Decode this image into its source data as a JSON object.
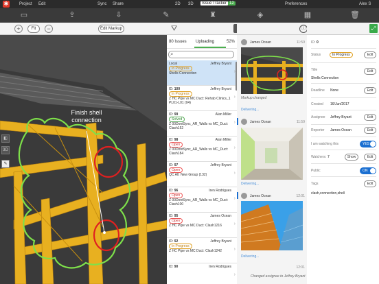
{
  "menubar": {
    "project": "Project",
    "edit": "Edit",
    "sync": "Sync",
    "share": "Share",
    "view_2d": "2D",
    "view_3d": "3D",
    "issue_tracker": "Issue Tracker",
    "issue_badge": "12",
    "preferences": "Preferences",
    "user": "Alex S"
  },
  "left_panel": {
    "zoom_in": "+",
    "fit": "Fit",
    "zoom_out": "−",
    "edit_markup": "Edit Markup",
    "markup_text": "Finish shell connection"
  },
  "list_panel": {
    "tabs": [
      {
        "label": "80 Issues"
      },
      {
        "label": "Uploading"
      }
    ],
    "upload_percent": "52%",
    "issues": [
      {
        "id_label": "Local",
        "id": "",
        "assignee": "Jeffrey Bryant",
        "status": "In Progress",
        "status_class": "inprog",
        "title": "Shells Connection",
        "selected": true
      },
      {
        "id_label": "ID:",
        "id": "100",
        "assignee": "Jeffrey Bryant",
        "status": "In Progress",
        "status_class": "inprog",
        "title": "Z HC Pipe vs MC Duct: Rehab Clinics_1 PL01-L01 (04)"
      },
      {
        "id_label": "ID:",
        "id": "99",
        "assignee": "Alan Miller",
        "status": "Solved",
        "status_class": "solved",
        "title": "Z 00DontSync_AR_Walls vs MC_Duct: Clash152"
      },
      {
        "id_label": "ID:",
        "id": "98",
        "assignee": "Alan Miller",
        "status": "Open",
        "status_class": "open",
        "title": "Z 00DontSync_AR_Walls vs MC_Duct: Clash184"
      },
      {
        "id_label": "ID:",
        "id": "97",
        "assignee": "Jeffrey Bryant",
        "status": "Open",
        "status_class": "open",
        "title": "QC All: New Group (132)"
      },
      {
        "id_label": "ID:",
        "id": "96",
        "assignee": "Iren Rodrigues",
        "status": "Open",
        "status_class": "open",
        "title": "Z 00DontSync_AR_Walls vs MC_Duct: Clash100"
      },
      {
        "id_label": "ID:",
        "id": "95",
        "assignee": "James Ocean",
        "status": "Open",
        "status_class": "open",
        "title": "Z HC Pipe vs MC Duct: Clash1216"
      },
      {
        "id_label": "ID:",
        "id": "92",
        "assignee": "Jeffrey Bryant",
        "status": "In Progress",
        "status_class": "inprog",
        "title": "Z HC Pipe vs MC Duct: Clash1242"
      },
      {
        "id_label": "ID:",
        "id": "90",
        "assignee": "Iren Rodrigues",
        "status": "",
        "status_class": "",
        "title": ""
      }
    ]
  },
  "messages": [
    {
      "name": "James Ocean",
      "time": "11:59",
      "caption": "Markup changed",
      "delivery": "Delivering..."
    },
    {
      "name": "James Ocean",
      "time": "11:59",
      "caption": "",
      "delivery": "Delivering..."
    },
    {
      "name": "James Ocean",
      "time": "12:01",
      "caption": "",
      "delivery": "Delivering..."
    },
    {
      "name": "",
      "time": "12:01",
      "caption": "Changed assignee to Jeffrey Bryant",
      "delivery": ""
    }
  ],
  "details": {
    "id_label": "ID:",
    "id_value": "0",
    "status_label": "Status",
    "status_value": "In Progress",
    "title_label": "Title",
    "title_value": "Shells Connection",
    "deadline_label": "Deadline",
    "deadline_value": "None",
    "created_label": "Created",
    "created_value": "16/Jun/2017",
    "assignee_label": "Assignee",
    "assignee_value": "Jeffrey Bryant",
    "reporter_label": "Reporter",
    "reporter_value": "James Ocean",
    "watching_label": "I am watching this",
    "watching_value": "YES",
    "watchers_label": "Watchers:",
    "watchers_value": "7",
    "show_label": "Show",
    "public_label": "Public",
    "public_value": "ON",
    "tags_label": "Tags",
    "tags_value": "clash,connection,shell",
    "edit_label": "Edit"
  },
  "colors": {
    "accent": "#1a6fd1",
    "in_progress": "#e0a020",
    "open": "#e55555",
    "solved": "#55aa55",
    "markup_green": "#7ee04a",
    "markup_red": "#e02020",
    "beam_yellow": "#e8b020"
  }
}
